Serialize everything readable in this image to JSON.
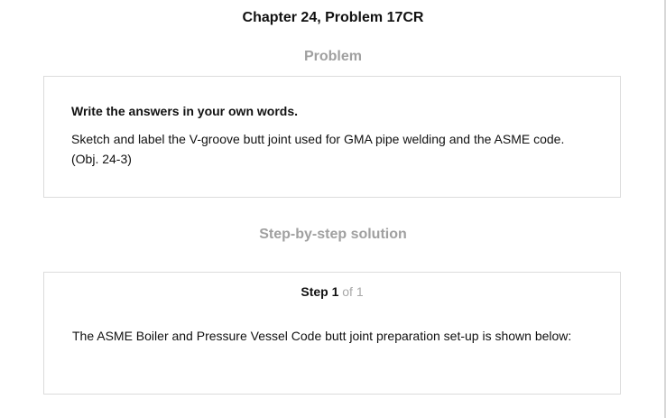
{
  "page": {
    "title": "Chapter 24, Problem 17CR"
  },
  "problem": {
    "heading": "Problem",
    "instruction": "Write the answers in your own words.",
    "question": "Sketch and label the V-groove butt joint used for GMA pipe welding and the ASME code. (Obj. 24-3)"
  },
  "solution": {
    "heading": "Step-by-step solution",
    "step_label": "Step 1",
    "step_of": "of 1",
    "text": "The ASME Boiler and Pressure Vessel Code butt joint preparation set-up is shown below:"
  }
}
